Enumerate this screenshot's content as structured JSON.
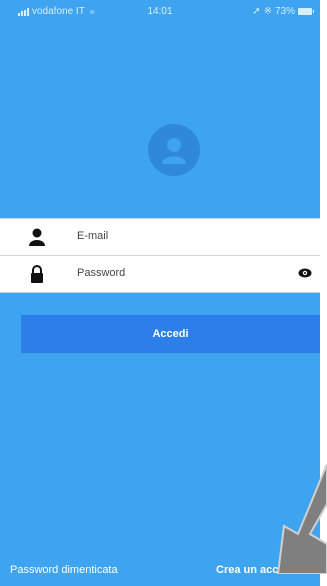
{
  "status_bar": {
    "carrier": "vodafone IT",
    "time": "14:01",
    "battery": "73%"
  },
  "login": {
    "email_label": "E-mail",
    "password_label": "Password",
    "submit_label": "Accedi"
  },
  "footer": {
    "forgot_password": "Password dimenticata",
    "create_account": "Crea un account"
  },
  "colors": {
    "background": "#3ea4ef",
    "button": "#2c7ee8",
    "avatar": "#2f88d9"
  },
  "icons": [
    "signal-icon",
    "wifi-icon",
    "location-icon",
    "bluetooth-icon",
    "battery-icon",
    "avatar-icon",
    "user-icon",
    "lock-icon",
    "eye-icon",
    "arrow-icon"
  ]
}
